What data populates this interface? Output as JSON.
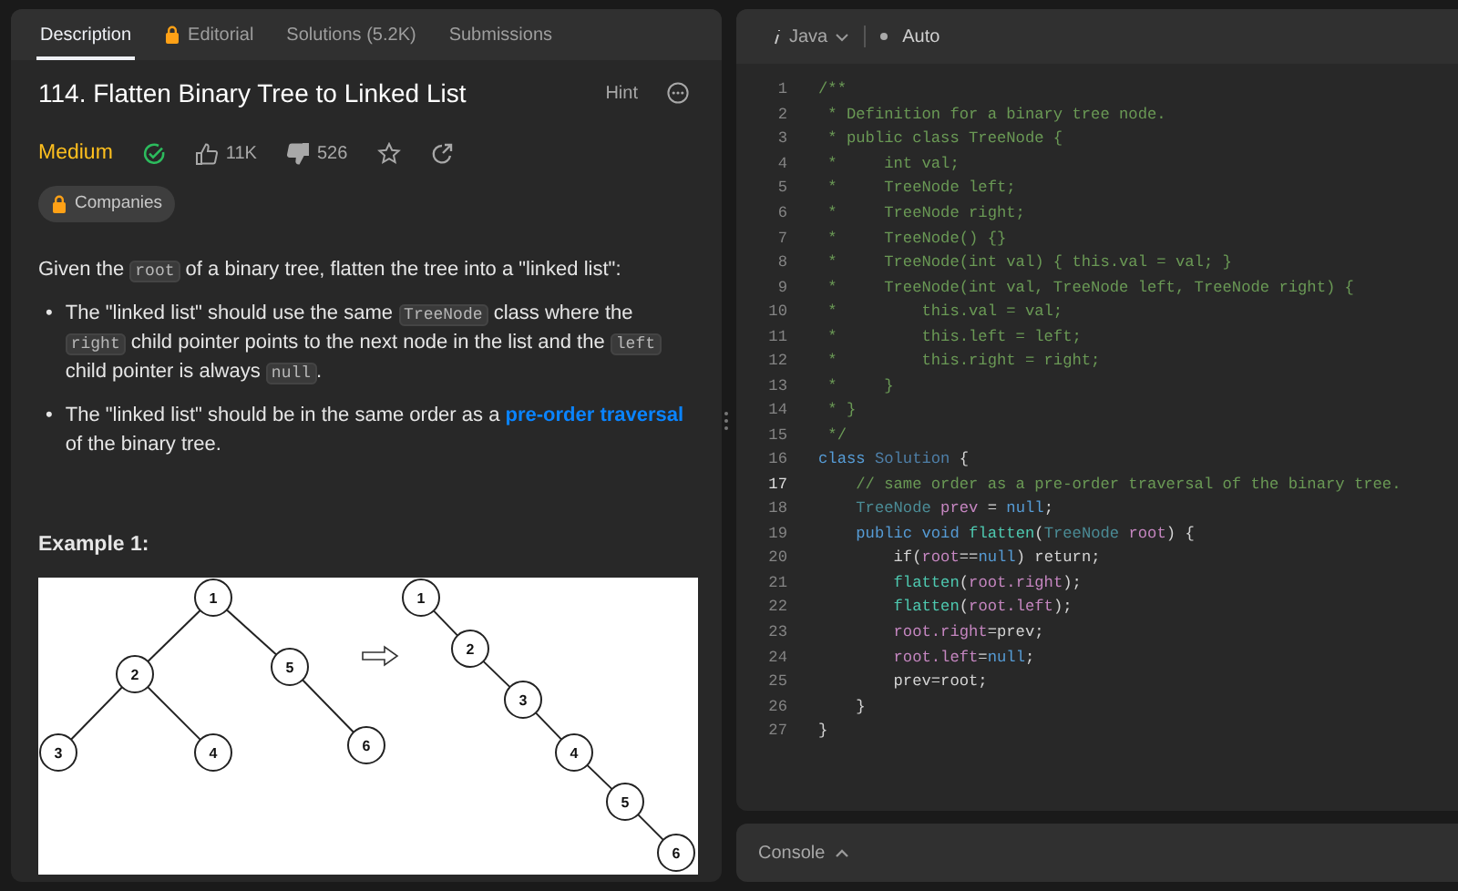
{
  "tabs": [
    {
      "label": "Description",
      "selected": true,
      "locked": false
    },
    {
      "label": "Editorial",
      "selected": false,
      "locked": true
    },
    {
      "label": "Solutions (5.2K)",
      "selected": false,
      "locked": false
    },
    {
      "label": "Submissions",
      "selected": false,
      "locked": false
    }
  ],
  "problem": {
    "title": "114. Flatten Binary Tree to Linked List",
    "hint": "Hint",
    "difficulty": "Medium",
    "solved": true,
    "likes": "11K",
    "dislikes": "526",
    "starred": false,
    "companies": "Companies"
  },
  "description": [
    {
      "text": "Given the ",
      "kind": "text"
    },
    {
      "text": "root",
      "kind": "code"
    },
    {
      "text": " of a binary tree, flatten the tree into a \"linked list\":",
      "kind": "text"
    }
  ],
  "bullets": [
    {
      "marker": "•",
      "segments": [
        {
          "text": "The \"linked list\" should use the same ",
          "kind": "text"
        },
        {
          "text": "TreeNode",
          "kind": "code"
        },
        {
          "text": " class where the ",
          "kind": "text"
        },
        {
          "text": "right",
          "kind": "code"
        },
        {
          "text": " child pointer points to the next node in the list and the ",
          "kind": "text"
        },
        {
          "text": "left",
          "kind": "code"
        },
        {
          "text": " child pointer is always ",
          "kind": "text"
        },
        {
          "text": "null",
          "kind": "code"
        },
        {
          "text": ".",
          "kind": "text"
        }
      ]
    },
    {
      "marker": "•",
      "segments": [
        {
          "text": "The \"linked list\" should be in the same order as a ",
          "kind": "text"
        },
        {
          "text": "pre-order traversal",
          "kind": "link"
        },
        {
          "text": " of the binary tree.",
          "kind": "text"
        }
      ]
    }
  ],
  "example": {
    "title": "Example 1:",
    "tree_nodes": [
      "1",
      "2",
      "5",
      "3",
      "4",
      "6"
    ],
    "list_nodes": [
      "1",
      "2",
      "3",
      "4",
      "5",
      "6"
    ]
  },
  "editor": {
    "language": "Java",
    "mode": "Auto"
  },
  "code": [
    {
      "number": "1",
      "current": false,
      "tokens": [
        {
          "text": "/**",
          "kind": "comment"
        }
      ]
    },
    {
      "number": "2",
      "current": false,
      "tokens": [
        {
          "text": " * Definition for a binary tree node.",
          "kind": "comment"
        }
      ]
    },
    {
      "number": "3",
      "current": false,
      "tokens": [
        {
          "text": " * public class TreeNode {",
          "kind": "comment"
        }
      ]
    },
    {
      "number": "4",
      "current": false,
      "tokens": [
        {
          "text": " *     int val;",
          "kind": "comment"
        }
      ]
    },
    {
      "number": "5",
      "current": false,
      "tokens": [
        {
          "text": " *     TreeNode left;",
          "kind": "comment"
        }
      ]
    },
    {
      "number": "6",
      "current": false,
      "tokens": [
        {
          "text": " *     TreeNode right;",
          "kind": "comment"
        }
      ]
    },
    {
      "number": "7",
      "current": false,
      "tokens": [
        {
          "text": " *     TreeNode() {}",
          "kind": "comment"
        }
      ]
    },
    {
      "number": "8",
      "current": false,
      "tokens": [
        {
          "text": " *     TreeNode(int val) { this.val = val; }",
          "kind": "comment"
        }
      ]
    },
    {
      "number": "9",
      "current": false,
      "tokens": [
        {
          "text": " *     TreeNode(int val, TreeNode left, TreeNode right) {",
          "kind": "comment"
        }
      ]
    },
    {
      "number": "10",
      "current": false,
      "tokens": [
        {
          "text": " *         this.val = val;",
          "kind": "comment"
        }
      ]
    },
    {
      "number": "11",
      "current": false,
      "tokens": [
        {
          "text": " *         this.left = left;",
          "kind": "comment"
        }
      ]
    },
    {
      "number": "12",
      "current": false,
      "tokens": [
        {
          "text": " *         this.right = right;",
          "kind": "comment"
        }
      ]
    },
    {
      "number": "13",
      "current": false,
      "tokens": [
        {
          "text": " *     }",
          "kind": "comment"
        }
      ]
    },
    {
      "number": "14",
      "current": false,
      "tokens": [
        {
          "text": " * }",
          "kind": "comment"
        }
      ]
    },
    {
      "number": "15",
      "current": false,
      "tokens": [
        {
          "text": " */",
          "kind": "comment"
        }
      ]
    },
    {
      "number": "16",
      "current": false,
      "tokens": [
        {
          "text": "class",
          "kind": "keyword"
        },
        {
          "text": " Solution",
          "kind": "class"
        },
        {
          "text": " {",
          "kind": "plain"
        }
      ]
    },
    {
      "number": "17",
      "current": true,
      "tokens": [
        {
          "text": "    // same order as a pre-order traversal of the binary tree.",
          "kind": "comment"
        }
      ]
    },
    {
      "number": "18",
      "current": false,
      "tokens": [
        {
          "text": "    TreeNode",
          "kind": "type"
        },
        {
          "text": " prev",
          "kind": "var"
        },
        {
          "text": " = ",
          "kind": "plain"
        },
        {
          "text": "null",
          "kind": "keyword"
        },
        {
          "text": ";",
          "kind": "plain"
        }
      ]
    },
    {
      "number": "19",
      "current": false,
      "tokens": [
        {
          "text": "    public",
          "kind": "keyword"
        },
        {
          "text": " void",
          "kind": "keyword"
        },
        {
          "text": " flatten",
          "kind": "function"
        },
        {
          "text": "(",
          "kind": "plain"
        },
        {
          "text": "TreeNode",
          "kind": "type"
        },
        {
          "text": " root",
          "kind": "var"
        },
        {
          "text": ") {",
          "kind": "plain"
        }
      ]
    },
    {
      "number": "20",
      "current": false,
      "tokens": [
        {
          "text": "        if(",
          "kind": "plain"
        },
        {
          "text": "root",
          "kind": "var"
        },
        {
          "text": "==",
          "kind": "plain"
        },
        {
          "text": "null",
          "kind": "keyword"
        },
        {
          "text": ") return;",
          "kind": "plain"
        }
      ]
    },
    {
      "number": "21",
      "current": false,
      "tokens": [
        {
          "text": "        flatten",
          "kind": "function"
        },
        {
          "text": "(",
          "kind": "plain"
        },
        {
          "text": "root.right",
          "kind": "var"
        },
        {
          "text": ");",
          "kind": "plain"
        }
      ]
    },
    {
      "number": "22",
      "current": false,
      "tokens": [
        {
          "text": "        flatten",
          "kind": "function"
        },
        {
          "text": "(",
          "kind": "plain"
        },
        {
          "text": "root.left",
          "kind": "var"
        },
        {
          "text": ");",
          "kind": "plain"
        }
      ]
    },
    {
      "number": "23",
      "current": false,
      "tokens": [
        {
          "text": "        root.right",
          "kind": "var"
        },
        {
          "text": "=prev;",
          "kind": "plain"
        }
      ]
    },
    {
      "number": "24",
      "current": false,
      "tokens": [
        {
          "text": "        root.left",
          "kind": "var"
        },
        {
          "text": "=",
          "kind": "plain"
        },
        {
          "text": "null",
          "kind": "keyword"
        },
        {
          "text": ";",
          "kind": "plain"
        }
      ]
    },
    {
      "number": "25",
      "current": false,
      "tokens": [
        {
          "text": "        prev=root;",
          "kind": "plain"
        }
      ]
    },
    {
      "number": "26",
      "current": false,
      "tokens": [
        {
          "text": "    }",
          "kind": "plain"
        }
      ]
    },
    {
      "number": "27",
      "current": false,
      "tokens": [
        {
          "text": "}",
          "kind": "plain"
        }
      ]
    }
  ],
  "console": {
    "label": "Console"
  }
}
